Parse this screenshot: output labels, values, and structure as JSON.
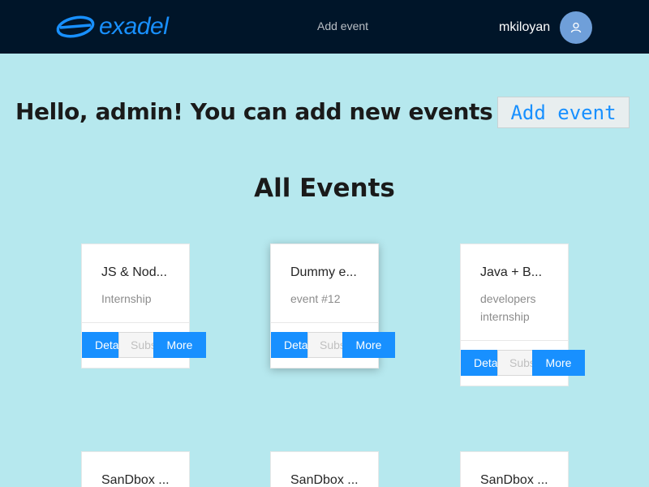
{
  "header": {
    "logo_text": "exadel",
    "nav_link": "Add event",
    "username": "mkiloyan",
    "avatar_icon": "user-icon"
  },
  "hero": {
    "greeting": "Hello, admin! You can add new events here:",
    "add_button": "Add event"
  },
  "section": {
    "title": "All Events"
  },
  "buttons": {
    "details": "Details",
    "subscribe": "Subscribe",
    "more": "More"
  },
  "events": [
    {
      "title": "JS & Nod...",
      "description": "Internship"
    },
    {
      "title": "Dummy e...",
      "description": "event #12"
    },
    {
      "title": "Java + B...",
      "description": "developers internship"
    },
    {
      "title": "SanDbox ...",
      "description": ""
    },
    {
      "title": "SanDbox ...",
      "description": ""
    },
    {
      "title": "SanDbox ...",
      "description": ""
    }
  ],
  "colors": {
    "page_background": "#b6e8ee",
    "navbar": "#001529",
    "primary": "#1890ff"
  }
}
